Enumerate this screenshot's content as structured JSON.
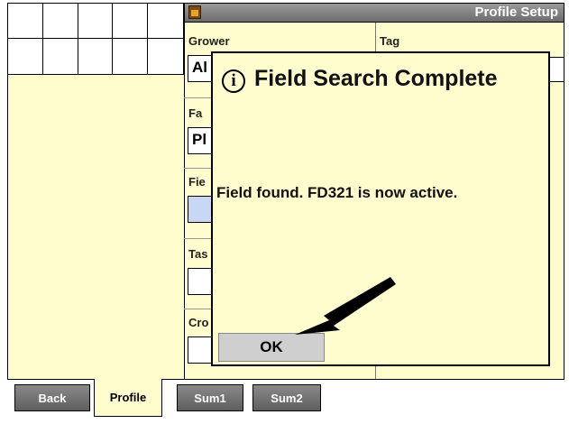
{
  "window": {
    "title": "Profile Setup",
    "icon": "app-icon"
  },
  "form": {
    "grower_label": "Grower",
    "grower_value": "Al",
    "tag_label": "Tag",
    "farm_label": "Fa",
    "farm_value": "Pl",
    "field_label": "Fie",
    "task_label": "Tas",
    "crop_label": "Cro"
  },
  "dialog": {
    "title": "Field Search Complete",
    "icon": "info-icon",
    "message": "Field found. FD321 is now active.",
    "ok_label": "OK"
  },
  "tabs": [
    {
      "label": "Back"
    },
    {
      "label": "Profile"
    },
    {
      "label": "Sum1"
    },
    {
      "label": "Sum2"
    }
  ]
}
